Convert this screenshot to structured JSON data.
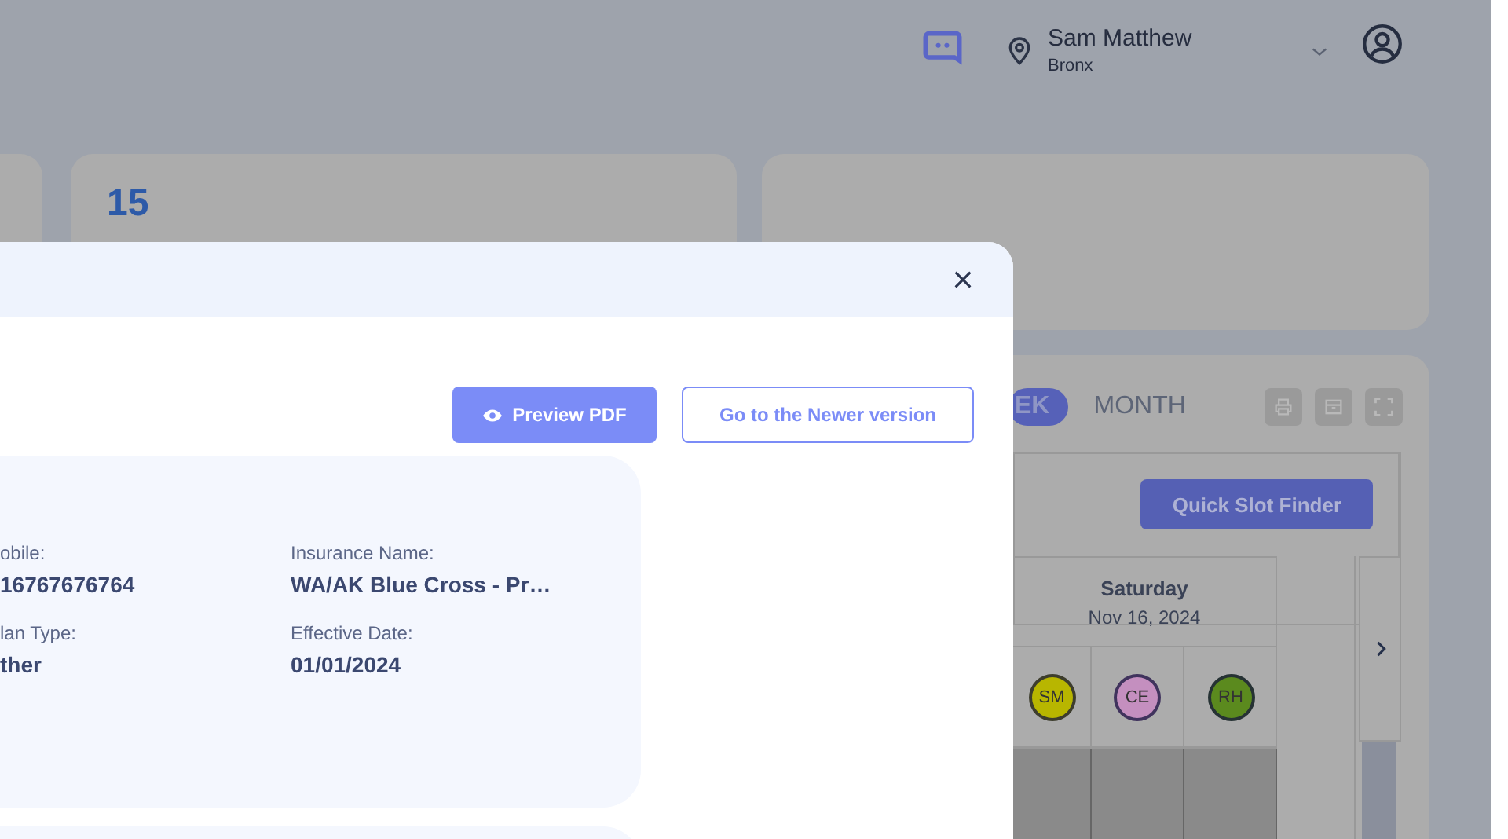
{
  "header": {
    "user_name": "Sam Matthew",
    "location": "Bronx"
  },
  "stat_cards": [
    {
      "value": "15"
    }
  ],
  "calendar": {
    "view_tabs": [
      {
        "label": "EK",
        "selected": true
      },
      {
        "label": "MONTH",
        "selected": false
      }
    ],
    "quick_slot_button": "Quick Slot Finder",
    "day": {
      "name": "Saturday",
      "date": "Nov 16, 2024"
    },
    "providers": [
      {
        "initials": "SM",
        "color": "#b8b600"
      },
      {
        "initials": "CE",
        "color": "#c48fbf"
      },
      {
        "initials": "RH",
        "color": "#5b8a1e"
      }
    ]
  },
  "modal": {
    "buttons": [
      {
        "label": "Preview PDF",
        "kind": "primary"
      },
      {
        "label": "Go to the Newer version",
        "kind": "outline"
      }
    ],
    "fields": [
      {
        "label": "obile:",
        "value": "16767676764"
      },
      {
        "label": "Insurance Name:",
        "value": "WA/AK Blue Cross - Pr…"
      },
      {
        "label": "lan Type:",
        "value": "ther"
      },
      {
        "label": "Effective Date:",
        "value": "01/01/2024"
      }
    ]
  }
}
